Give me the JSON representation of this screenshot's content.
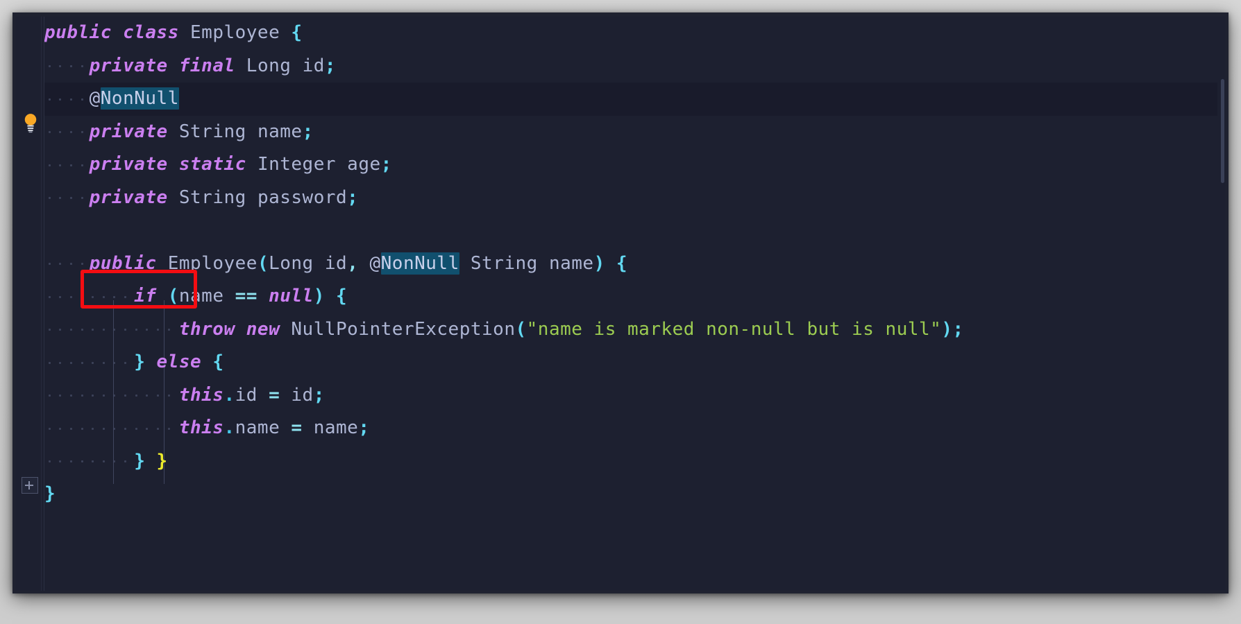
{
  "window": {
    "title": "Employee.java",
    "editor_background": "#1d2030",
    "current_line_background": "#191b2b",
    "highlight_color": "#11506e",
    "annotation_box_color": "#f40d12"
  },
  "gutter": {
    "lightbulb_icon": "lightbulb-icon",
    "lightbulb_color": "#f9a825",
    "fold_icon": "fold-expand-icon",
    "fold_line": 13
  },
  "code": {
    "language": "java",
    "lines": [
      {
        "n": 1,
        "indent": 0,
        "text": "public class Employee {"
      },
      {
        "n": 2,
        "indent": 1,
        "text": "private final Long id;"
      },
      {
        "n": 3,
        "indent": 1,
        "text": "@NonNull",
        "current": true,
        "bulb": true
      },
      {
        "n": 4,
        "indent": 1,
        "text": "private String name;"
      },
      {
        "n": 5,
        "indent": 1,
        "text": "private static Integer age;"
      },
      {
        "n": 6,
        "indent": 1,
        "text": "private String password;"
      },
      {
        "n": 7,
        "indent": 0,
        "text": ""
      },
      {
        "n": 8,
        "indent": 1,
        "text": "public Employee(Long id, @NonNull String name) {",
        "boxed": "public"
      },
      {
        "n": 9,
        "indent": 2,
        "text": "if (name == null) {"
      },
      {
        "n": 10,
        "indent": 3,
        "text": "throw new NullPointerException(\"name is marked non-null but is null\");"
      },
      {
        "n": 11,
        "indent": 2,
        "text": "} else {"
      },
      {
        "n": 12,
        "indent": 3,
        "text": "this.id = id;"
      },
      {
        "n": 13,
        "indent": 3,
        "text": "this.name = name;"
      },
      {
        "n": 14,
        "indent": 2,
        "text": "} }"
      },
      {
        "n": 15,
        "indent": 0,
        "text": "}"
      }
    ],
    "tokens": {
      "l1": {
        "kw1": "public",
        "kw2": "class",
        "name": "Employee",
        "brace": "{"
      },
      "l2": {
        "kw1": "private",
        "kw2": "final",
        "type": "Long",
        "name": "id",
        "semi": ";"
      },
      "l3": {
        "annotation": "@",
        "annotation_name": "NonNull"
      },
      "l4": {
        "kw1": "private",
        "type": "String",
        "name": "name",
        "semi": ";"
      },
      "l5": {
        "kw1": "private",
        "kw2": "static",
        "type": "Integer",
        "name": "age",
        "semi": ";"
      },
      "l6": {
        "kw1": "private",
        "type": "String",
        "name": "password",
        "semi": ";"
      },
      "l8": {
        "kw1": "public",
        "ctor": "Employee",
        "lp": "(",
        "t1": "Long",
        "a1": "id",
        "comma": ",",
        "annotation": "@",
        "annotation_name": "NonNull",
        "t2": "String",
        "a2": "name",
        "rp": ")",
        "brace": "{"
      },
      "l9": {
        "kw": "if",
        "lp": "(",
        "id": "name",
        "op": "==",
        "nullkw": "null",
        "rp": ")",
        "brace": "{"
      },
      "l10": {
        "kw1": "throw",
        "kw2": "new",
        "type": "NullPointerException",
        "lp": "(",
        "string": "\"name is marked non-null but is null\"",
        "rp": ")",
        "semi": ";"
      },
      "l11": {
        "rbrace": "}",
        "kw": "else",
        "lbrace": "{"
      },
      "l12": {
        "kw": "this",
        "dot": ".",
        "field": "id",
        "op": "=",
        "val": "id",
        "semi": ";"
      },
      "l13": {
        "kw": "this",
        "dot": ".",
        "field": "name",
        "op": "=",
        "val": "name",
        "semi": ";"
      },
      "l14": {
        "b1": "}",
        "b2": "}"
      },
      "l15": {
        "b1": "}"
      }
    },
    "colors": {
      "keyword": "#cb7ff0",
      "identifier": "#aeb6d4",
      "string": "#9ccc51",
      "operator": "#8fe3f0",
      "brace_cyan": "#62d8f1",
      "brace_yellow": "#ecea2c",
      "indent_dot": "#3b4158"
    }
  }
}
